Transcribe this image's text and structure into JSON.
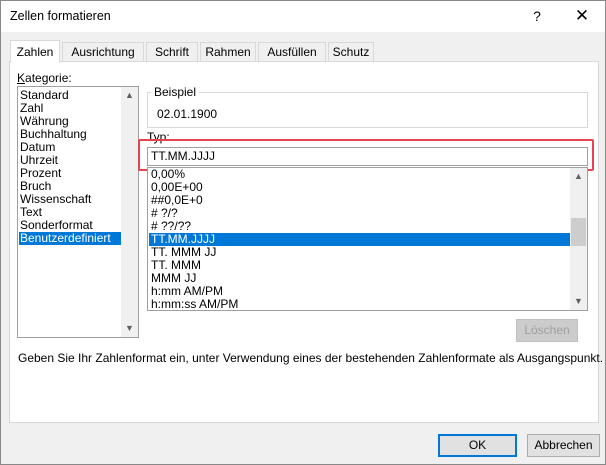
{
  "window": {
    "title": "Zellen formatieren",
    "help_icon": "?",
    "close_icon": "✕"
  },
  "tabs": [
    {
      "label": "Zahlen",
      "active": true
    },
    {
      "label": "Ausrichtung",
      "active": false
    },
    {
      "label": "Schrift",
      "active": false
    },
    {
      "label": "Rahmen",
      "active": false
    },
    {
      "label": "Ausfüllen",
      "active": false
    },
    {
      "label": "Schutz",
      "active": false
    }
  ],
  "category": {
    "label": "Kategorie:",
    "items": [
      "Standard",
      "Zahl",
      "Währung",
      "Buchhaltung",
      "Datum",
      "Uhrzeit",
      "Prozent",
      "Bruch",
      "Wissenschaft",
      "Text",
      "Sonderformat",
      "Benutzerdefiniert"
    ],
    "selected": "Benutzerdefiniert"
  },
  "sample": {
    "label": "Beispiel",
    "value": "02.01.1900"
  },
  "type": {
    "label": "Typ:",
    "value": "TT.MM.JJJJ",
    "formats": [
      "0,00%",
      "0,00E+00",
      "##0,0E+0",
      "# ?/?",
      "# ??/??",
      "TT.MM.JJJJ",
      "TT. MMM JJ",
      "TT. MMM",
      "MMM JJ",
      "h:mm AM/PM",
      "h:mm:ss AM/PM"
    ],
    "selected": "TT.MM.JJJJ"
  },
  "buttons": {
    "delete": "Löschen",
    "ok": "OK",
    "cancel": "Abbrechen"
  },
  "description": "Geben Sie Ihr Zahlenformat ein, unter Verwendung eines der bestehenden Zahlenformate als Ausgangspunkt.",
  "colors": {
    "selection": "#0078d7",
    "highlight_box": "#e4454f"
  }
}
